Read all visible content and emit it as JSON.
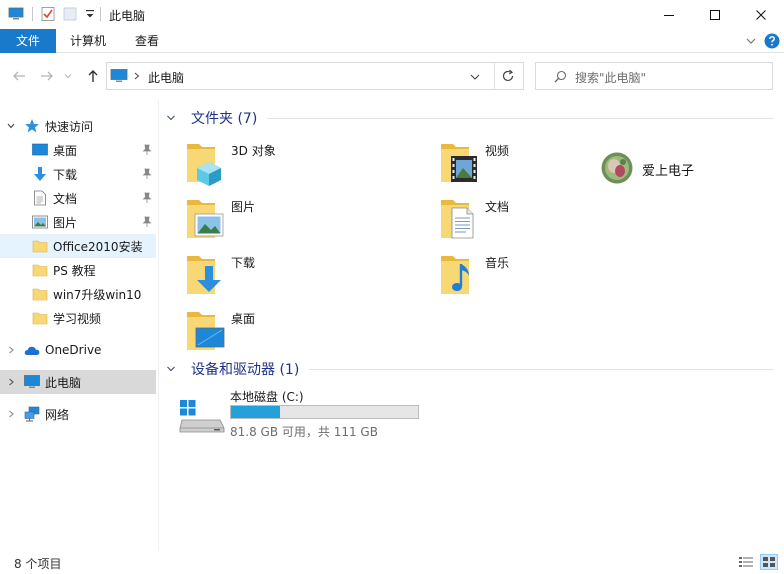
{
  "window": {
    "title": "此电脑"
  },
  "ribbon": {
    "tabs": [
      "文件",
      "计算机",
      "查看"
    ]
  },
  "address": {
    "location": "此电脑"
  },
  "search": {
    "placeholder": "搜索\"此电脑\""
  },
  "nav": {
    "quick_access": "快速访问",
    "items": [
      "桌面",
      "下载",
      "文档",
      "图片",
      "Office2010安装",
      "PS 教程",
      "win7升级win10",
      "学习视频"
    ],
    "onedrive": "OneDrive",
    "this_pc": "此电脑",
    "network": "网络"
  },
  "content": {
    "folders_header": "文件夹 (7)",
    "folders": [
      "3D 对象",
      "视频",
      "图片",
      "文档",
      "下载",
      "音乐",
      "桌面"
    ],
    "extra_item": "爱上电子",
    "devices_header": "设备和驱动器 (1)",
    "drive": {
      "name": "本地磁盘 (C:)",
      "info": "81.8 GB 可用，共 111 GB",
      "used_fraction": 0.263
    }
  },
  "status": {
    "count": "8 个项目"
  },
  "colors": {
    "accent": "#1979ca",
    "group_title": "#1e3287",
    "drive_bar": "#26a0da",
    "folder": "#f8d775"
  }
}
